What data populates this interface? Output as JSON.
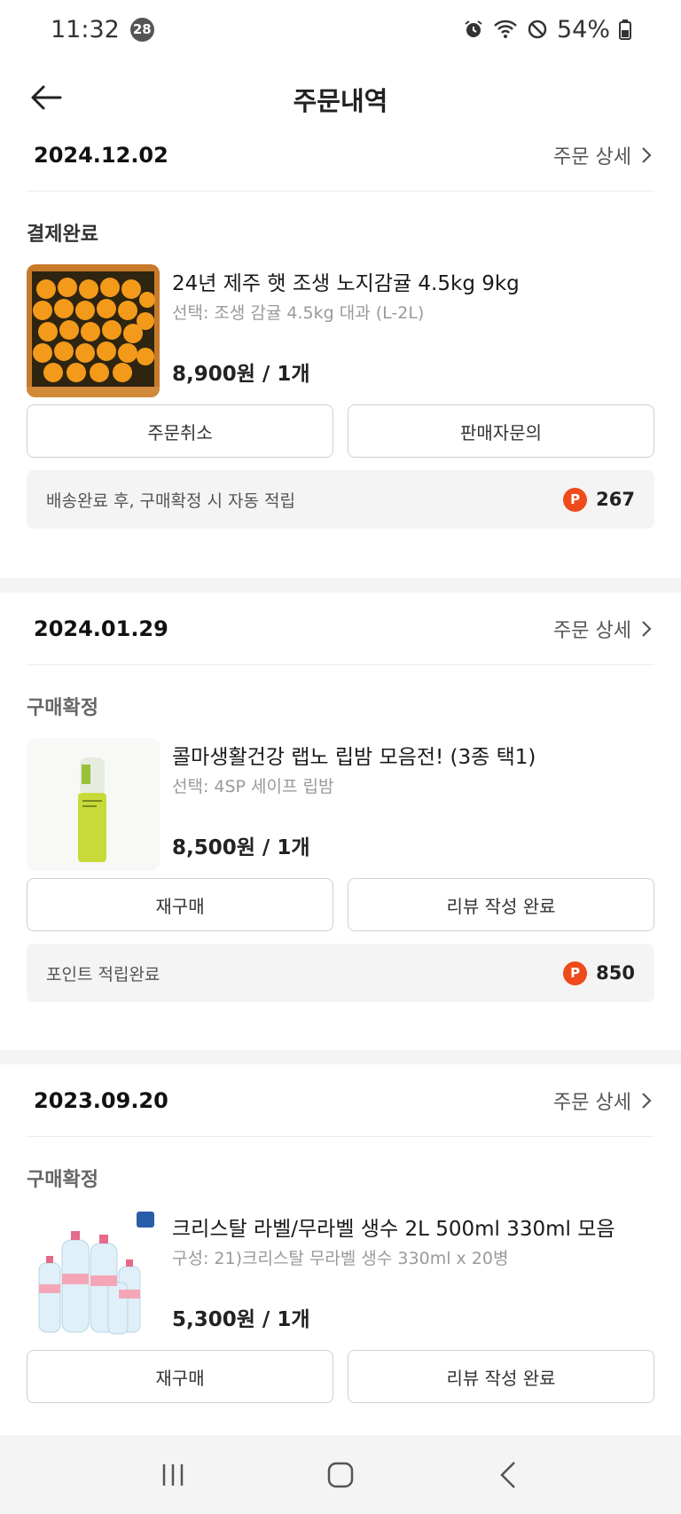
{
  "status_bar": {
    "time": "11:32",
    "notification_count": "28",
    "battery": "54%",
    "icons": [
      "alarm-icon",
      "wifi-icon",
      "do-not-disturb-icon",
      "battery-icon"
    ]
  },
  "header": {
    "title": "주문내역",
    "back_icon": "back-arrow-icon"
  },
  "orders": [
    {
      "date": "2024.12.02",
      "detail_label": "주문 상세",
      "status": "결제완료",
      "product_name": "24년 제주 햇 조생 노지감귤 4.5kg 9kg",
      "option": "선택: 조생 감귤 4.5kg 대과 (L-2L)",
      "price": "8,900원 / 1개",
      "buttons": [
        "주문취소",
        "판매자문의"
      ],
      "point_text": "배송완료 후, 구매확정 시 자동 적립",
      "point_badge": "P",
      "points": "267"
    },
    {
      "date": "2024.01.29",
      "detail_label": "주문 상세",
      "status": "구매확정",
      "product_name": "콜마생활건강 랩노 립밤 모음전! (3종 택1)",
      "option": "선택: 4SP 세이프 립밤",
      "price": "8,500원 / 1개",
      "buttons": [
        "재구매",
        "리뷰 작성 완료"
      ],
      "point_text": "포인트 적립완료",
      "point_badge": "P",
      "points": "850"
    },
    {
      "date": "2023.09.20",
      "detail_label": "주문 상세",
      "status": "구매확정",
      "product_name": "크리스탈 라벨/무라벨 생수 2L 500ml 330ml 모음",
      "option": "구성: 21)크리스탈 무라벨 생수 330ml x 20병",
      "price": "5,300원 / 1개",
      "buttons": [
        "재구매",
        "리뷰 작성 완료"
      ]
    }
  ],
  "nav_bar": {
    "icons": [
      "recent-apps-icon",
      "home-icon",
      "back-icon"
    ]
  },
  "colors": {
    "point_badge": "#ef4a1b",
    "section_divider": "#f3f3f3",
    "point_box": "#f4f4f4"
  }
}
